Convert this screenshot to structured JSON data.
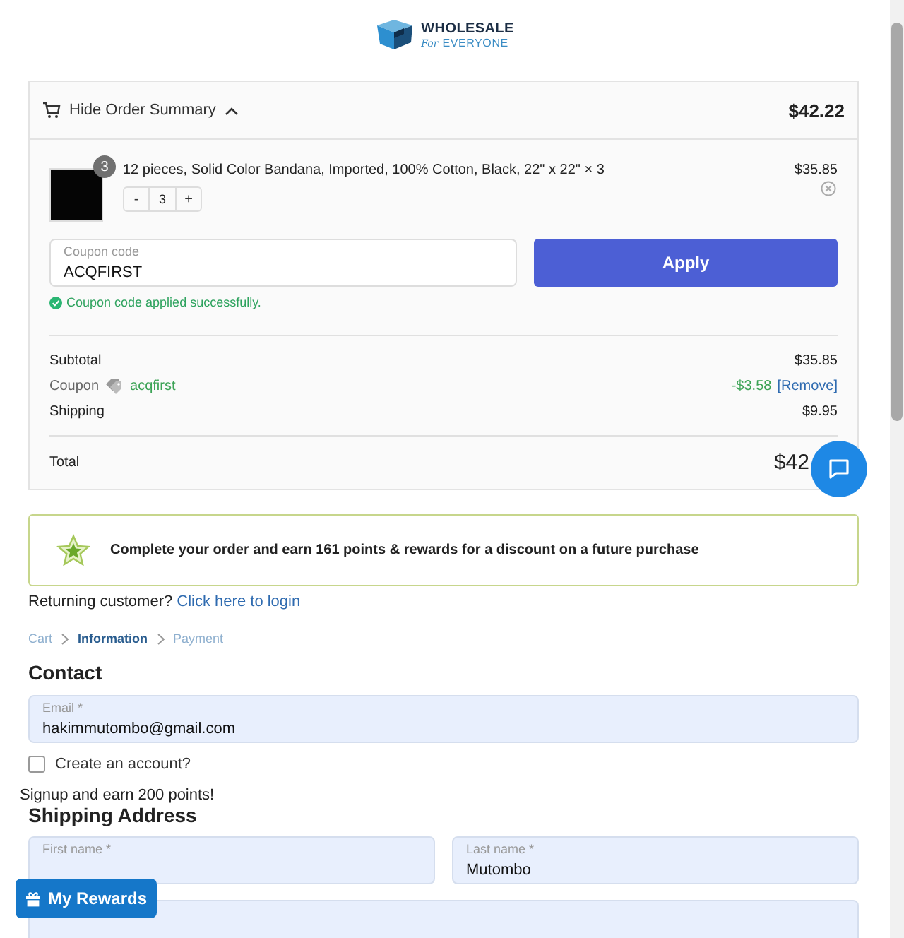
{
  "logo": {
    "name": "WHOLESALE",
    "tagline_script": "For",
    "tagline": "EVERYONE"
  },
  "order_summary": {
    "toggle_label": "Hide Order Summary",
    "expanded": true,
    "total": "$42.22",
    "items": [
      {
        "quantity_badge": "3",
        "title": "12 pieces, Solid Color Bandana, Imported, 100% Cotton, Black, 22\" x 22\" × 3",
        "price": "$35.85",
        "minus": "-",
        "quantity": "3",
        "plus": "+"
      }
    ],
    "coupon": {
      "placeholder": "Coupon code",
      "value": "ACQFIRST",
      "button": "Apply",
      "message": "Coupon code applied successfully."
    },
    "lines": [
      {
        "kind": "plain",
        "label": "Subtotal",
        "value": "$35.85"
      },
      {
        "kind": "coupon",
        "label": "Coupon",
        "code": "acqfirst",
        "value": "-$3.58",
        "action": "[Remove]"
      },
      {
        "kind": "plain",
        "label": "Shipping",
        "value": "$9.95"
      }
    ],
    "total_label": "Total",
    "total_value": "$42"
  },
  "rewards_banner": "Complete your order and earn 161 points & rewards for a discount on a future purchase",
  "returning": {
    "text": "Returning customer?",
    "link": "Click here to login"
  },
  "breadcrumbs": [
    {
      "label": "Cart",
      "selected": false
    },
    {
      "label": "Information",
      "selected": true
    },
    {
      "label": "Payment",
      "selected": false
    }
  ],
  "contact": {
    "heading": "Contact",
    "email": {
      "placeholder": "Email *",
      "value": "hakimmutombo@gmail.com"
    },
    "create_account": {
      "label": "Create an account?",
      "checked": false
    }
  },
  "signup_note": "Signup and earn 200 points!",
  "shipping": {
    "heading": "Shipping Address",
    "fields": [
      {
        "placeholder": "First name *"
      },
      {
        "placeholder": "Last name *",
        "value": "Mutombo"
      }
    ]
  },
  "my_rewards_button": "My Rewards"
}
